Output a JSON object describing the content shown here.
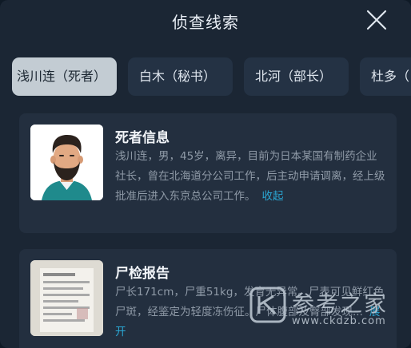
{
  "header": {
    "title": "侦查线索"
  },
  "tabs": [
    {
      "label": "浅川连（死者）",
      "active": true
    },
    {
      "label": "白木（秘书）",
      "active": false
    },
    {
      "label": "北河（部长）",
      "active": false
    },
    {
      "label": "杜多（",
      "active": false
    }
  ],
  "cards": {
    "victim": {
      "title": "死者信息",
      "body": "浅川连，男，45岁，离异，目前为日本某国有制药企业社长，曾在北海道分公司工作，后主动申请调离，经上级批准后进入东京总公司工作。",
      "toggle": "收起"
    },
    "autopsy": {
      "title": "尸检报告",
      "body": "尸长171cm，尸重51kg，发育无异常。尸表可见鲜红色尸斑，经鉴定为轻度冻伤征。尸体腹部及臀部发现...",
      "toggle": "展开"
    }
  },
  "watermark": {
    "text": "参考之家",
    "url": "www.ckdzb.com"
  },
  "colors": {
    "accent": "#2aa6d2",
    "active_tab": "#c3ccd3",
    "card_bg": "#232f3f",
    "panel_bg": "#1b2634"
  }
}
